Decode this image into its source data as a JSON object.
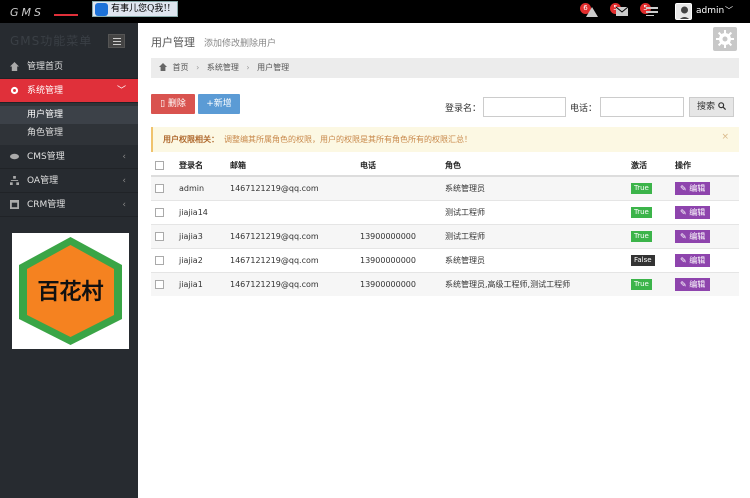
{
  "topbar": {
    "logo_text": "GMS",
    "qq_text": "有事儿您Q我!!",
    "notifications": [
      {
        "count": "6",
        "icon": "warning-icon"
      },
      {
        "count": "5",
        "icon": "envelope-icon"
      },
      {
        "count": "5",
        "icon": "tasks-icon"
      }
    ],
    "user_name": "admin",
    "caret": "﹀"
  },
  "sidebar": {
    "title": "GMS功能菜单",
    "items": [
      {
        "label": "管理首页",
        "icon": "home-icon"
      },
      {
        "label": "系统管理",
        "icon": "gear-icon",
        "chevron": "﹀"
      },
      {
        "label": "CMS管理",
        "icon": "leaf-icon",
        "chevron": "‹"
      },
      {
        "label": "OA管理",
        "icon": "sitemap-icon",
        "chevron": "‹"
      },
      {
        "label": "CRM管理",
        "icon": "table-icon",
        "chevron": "‹"
      }
    ],
    "submenu": [
      {
        "label": "用户管理"
      },
      {
        "label": "角色管理"
      }
    ],
    "ad_text": "百花村"
  },
  "main": {
    "title": "用户管理",
    "subtitle": "添加修改删除用户",
    "breadcrumb": [
      "首页",
      "系统管理",
      "用户管理"
    ],
    "toolbar": {
      "delete_label": "删除",
      "new_label": "新增",
      "login_label": "登录名：",
      "login_value": "",
      "phone_label": "电话：",
      "phone_value": "",
      "search_label": "搜索"
    },
    "alert": {
      "title": "用户权限相关：",
      "text": "调整编其所属角色的权限，用户的权限是其所有角色所有的权限汇总！",
      "close": "×"
    },
    "table": {
      "headers": [
        "登录名",
        "邮箱",
        "电话",
        "角色",
        "激活",
        "操作"
      ],
      "rows": [
        {
          "login": "admin",
          "email": "1467121219@qq.com",
          "phone": "",
          "role": "系统管理员",
          "active": "True",
          "action": "编辑"
        },
        {
          "login": "jiajia14",
          "email": "",
          "phone": "",
          "role": "测试工程师",
          "active": "True",
          "action": "编辑"
        },
        {
          "login": "jiajia3",
          "email": "1467121219@qq.com",
          "phone": "13900000000",
          "role": "测试工程师",
          "active": "True",
          "action": "编辑"
        },
        {
          "login": "jiajia2",
          "email": "1467121219@qq.com",
          "phone": "13900000000",
          "role": "系统管理员",
          "active": "False",
          "action": "编辑"
        },
        {
          "login": "jiajia1",
          "email": "1467121219@qq.com",
          "phone": "13900000000",
          "role": "系统管理员,高级工程师,测试工程师",
          "active": "True",
          "action": "编辑"
        }
      ]
    }
  },
  "colors": {
    "accent_red": "#e0303a",
    "sidebar_bg": "#272b30",
    "btn_blue": "#5b9bd5",
    "edit_purple": "#8e44ad",
    "true_green": "#3cb44a"
  }
}
